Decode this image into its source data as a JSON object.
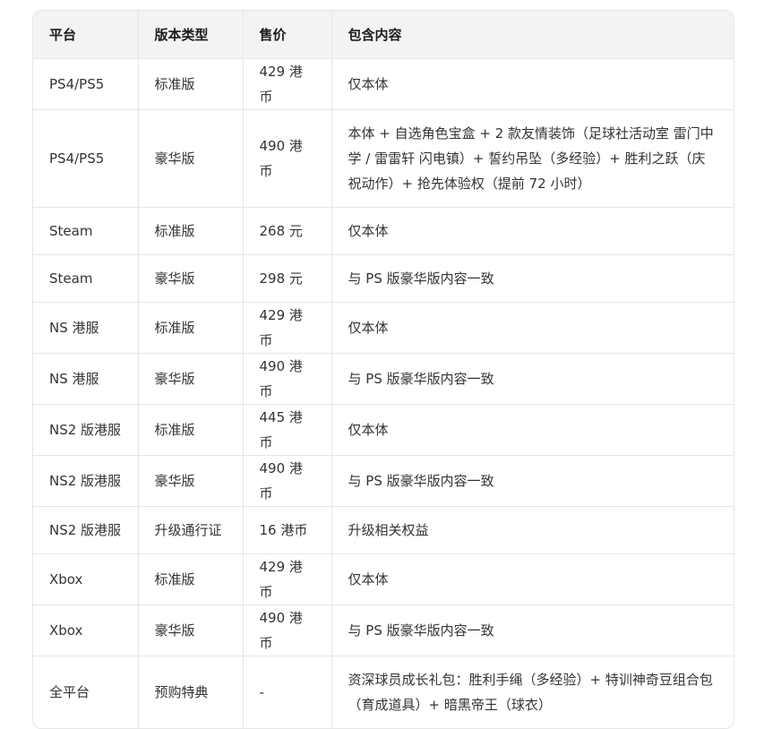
{
  "table": {
    "headers": [
      "平台",
      "版本类型",
      "售价",
      "包含内容"
    ],
    "rows": [
      [
        "PS4/PS5",
        "标准版",
        "429 港币",
        "仅本体"
      ],
      [
        "PS4/PS5",
        "豪华版",
        "490 港币",
        "本体 + 自选角色宝盒 + 2 款友情装饰（足球社活动室 雷门中学 / 雷雷轩 闪电镇）+ 誓约吊坠（多经验）+ 胜利之跃（庆祝动作）+ 抢先体验权（提前 72 小时）"
      ],
      [
        "Steam",
        "标准版",
        "268 元",
        "仅本体"
      ],
      [
        "Steam",
        "豪华版",
        "298 元",
        "与 PS 版豪华版内容一致"
      ],
      [
        "NS 港服",
        "标准版",
        "429 港币",
        "仅本体"
      ],
      [
        "NS 港服",
        "豪华版",
        "490 港币",
        "与 PS 版豪华版内容一致"
      ],
      [
        "NS2 版港服",
        "标准版",
        "445 港币",
        "仅本体"
      ],
      [
        "NS2 版港服",
        "豪华版",
        "490 港币",
        "与 PS 版豪华版内容一致"
      ],
      [
        "NS2 版港服",
        "升级通行证",
        "16 港币",
        "升级相关权益"
      ],
      [
        "Xbox",
        "标准版",
        "429 港币",
        "仅本体"
      ],
      [
        "Xbox",
        "豪华版",
        "490 港币",
        "与 PS 版豪华版内容一致"
      ],
      [
        "全平台",
        "预购特典",
        "-",
        "资深球员成长礼包：胜利手绳（多经验）+ 特训神奇豆组合包（育成道具）+ 暗黑帝王（球衣）"
      ]
    ]
  }
}
